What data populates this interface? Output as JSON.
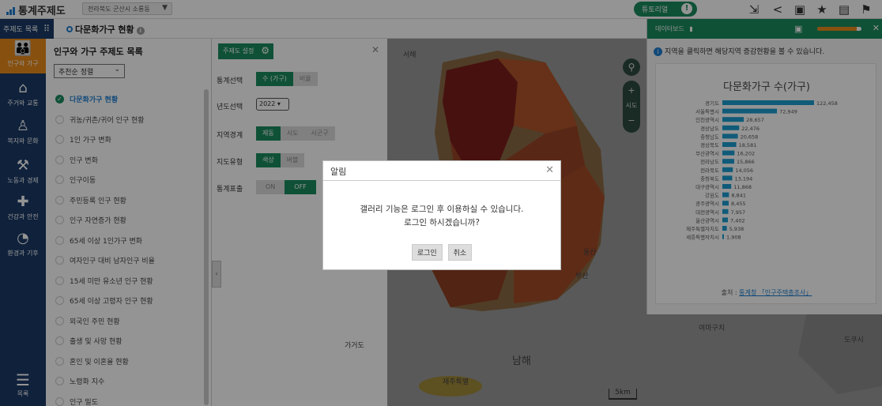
{
  "app": {
    "title": "통계주제도"
  },
  "region_select": {
    "value": "전라북도 군산시 소룡동"
  },
  "tutorial": {
    "label": "튜토리얼",
    "icon": "info-icon"
  },
  "toolbar_icons": [
    "shrink-icon",
    "share-icon",
    "image-icon",
    "star-icon",
    "document-icon",
    "bookmark-icon"
  ],
  "subbar": {
    "menu_label": "주제도 목록",
    "page_title": "다문화가구 현황"
  },
  "rail": {
    "items": [
      {
        "label": "인구와 가구",
        "icon": "people-icon"
      },
      {
        "label": "주거와 교통",
        "icon": "house-icon"
      },
      {
        "label": "복지와 문화",
        "icon": "welfare-icon"
      },
      {
        "label": "노동과 경제",
        "icon": "worker-icon"
      },
      {
        "label": "건강과 안전",
        "icon": "health-icon"
      },
      {
        "label": "환경과 기후",
        "icon": "environment-icon"
      }
    ],
    "menu_label": "목록"
  },
  "list_panel": {
    "title": "인구와 가구 주제도 목록",
    "sort": "추천순 정렬",
    "items": [
      "다문화가구 현황",
      "귀농/귀촌/귀어 인구 현황",
      "1인 가구 변화",
      "인구 변화",
      "인구이동",
      "주민등록 인구 현황",
      "인구 자연증가 현황",
      "65세 이상 1인가구 변화",
      "여자인구 대비 남자인구 비율",
      "15세 미만 유소년 인구 현황",
      "65세 이상 고령자 인구 현황",
      "외국인 주민 현황",
      "출생 및 사망 현황",
      "혼인 및 이혼율 현황",
      "노령화 지수",
      "인구 밀도"
    ]
  },
  "settings": {
    "header": "주제도 설정",
    "rows": [
      {
        "label": "통계선택",
        "options": [
          "수 (가구)",
          "비율"
        ],
        "selected": 0
      },
      {
        "label": "년도선택",
        "year": "2022"
      },
      {
        "label": "지역경계",
        "options": [
          "제동",
          "시도",
          "시군구"
        ],
        "selected": 0
      },
      {
        "label": "지도유형",
        "options": [
          "색상",
          "버블"
        ],
        "selected": 0
      },
      {
        "label": "통계표출",
        "options": [
          "ON",
          "OFF"
        ],
        "selected": 1
      }
    ]
  },
  "map": {
    "labels": [
      "서해",
      "울산",
      "부산",
      "가거도",
      "남해",
      "제주특별",
      "여마구치",
      "도쿠시"
    ],
    "zoom": {
      "plus": "+",
      "minus": "−",
      "level": "시도"
    },
    "scale": "5km"
  },
  "dashboard": {
    "header": "데이터보드",
    "note": "지역을 클릭하면 해당지역 증감현황을 볼 수 있습니다.",
    "source_prefix": "출처 : ",
    "source_link": "통계청 「인구주택총조사」",
    "progress": 0.9
  },
  "chart_data": {
    "type": "bar",
    "title": "다문화가구 수(가구)",
    "categories": [
      "경기도",
      "서울특별시",
      "인천광역시",
      "경상남도",
      "충청남도",
      "경상북도",
      "부산광역시",
      "전라남도",
      "전라북도",
      "충청북도",
      "대구광역시",
      "강원도",
      "광주광역시",
      "대전광역시",
      "울산광역시",
      "제주특별자치도",
      "세종특별자치시"
    ],
    "values": [
      122458,
      72949,
      28657,
      22476,
      20658,
      18581,
      16202,
      15866,
      14056,
      13194,
      11868,
      8841,
      8455,
      7957,
      7402,
      5938,
      1908
    ],
    "color": "#1a9ed0"
  },
  "dialog": {
    "title": "알림",
    "message_line1": "갤러리 기능은 로그인 후 이용하실 수 있습니다.",
    "message_line2": "로그인 하시겠습니까?",
    "confirm": "로그인",
    "cancel": "취소"
  }
}
